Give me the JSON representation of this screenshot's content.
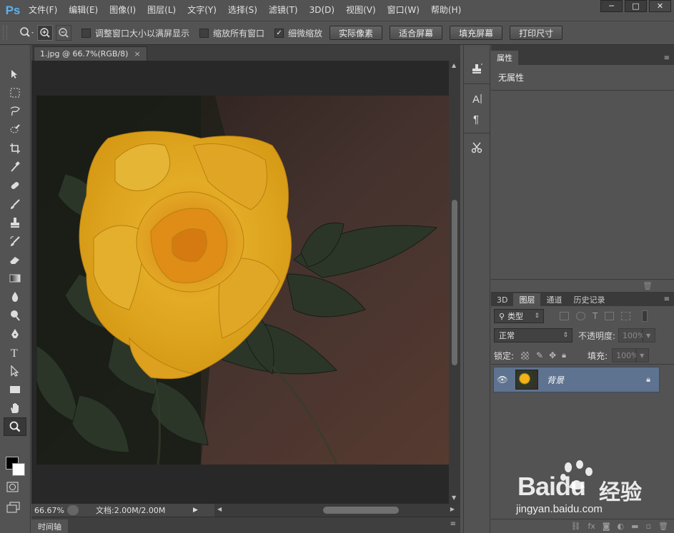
{
  "app": {
    "logo": "Ps",
    "menu": [
      "文件(F)",
      "编辑(E)",
      "图像(I)",
      "图层(L)",
      "文字(Y)",
      "选择(S)",
      "滤镜(T)",
      "3D(D)",
      "视图(V)",
      "窗口(W)",
      "帮助(H)"
    ],
    "window_controls": [
      "─",
      "□",
      "✕"
    ]
  },
  "options": {
    "checkbox1_label": "调整窗口大小以满屏显示",
    "checkbox2_label": "缩放所有窗口",
    "checkbox3_label": "细微缩放",
    "checkbox3_checked": "✓",
    "btn_actual": "实际像素",
    "btn_fit": "适合屏幕",
    "btn_fill": "填充屏幕",
    "btn_print": "打印尺寸"
  },
  "document": {
    "tab_title": "1.jpg @ 66.7%(RGB/8)",
    "tab_close": "×",
    "zoom": "66.67%",
    "doc_info": "文档:2.00M/2.00M",
    "timeline_label": "时间轴"
  },
  "properties_panel": {
    "tab": "属性",
    "message": "无属性"
  },
  "layers_panel": {
    "tabs": [
      "3D",
      "图层",
      "通道",
      "历史记录"
    ],
    "filter_label": "类型",
    "blend_mode": "正常",
    "opacity_label": "不透明度:",
    "opacity_value": "100%",
    "lock_label": "锁定:",
    "fill_label": "填充:",
    "fill_value": "100%",
    "layer_name": "背景"
  },
  "watermark": {
    "brand": "Baidu",
    "brand_cn": "经验",
    "url": "jingyan.baidu.com"
  }
}
